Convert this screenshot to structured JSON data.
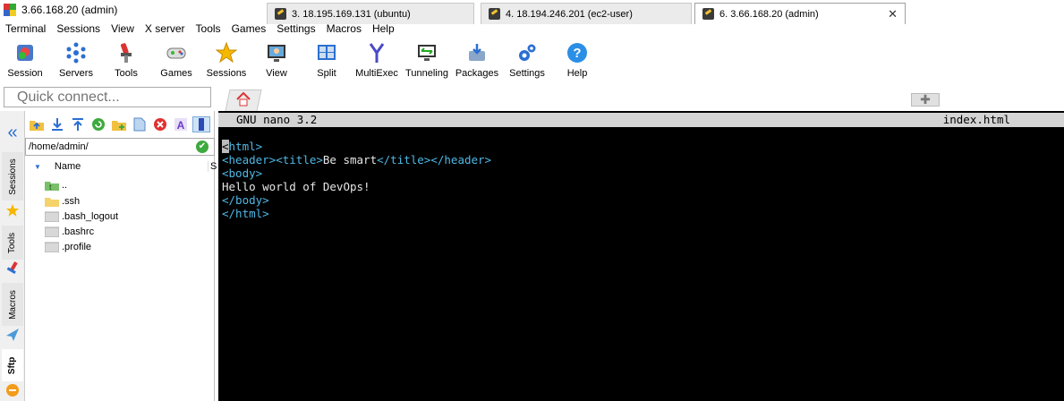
{
  "window": {
    "title": "3.66.168.20 (admin)"
  },
  "menu": [
    "Terminal",
    "Sessions",
    "View",
    "X server",
    "Tools",
    "Games",
    "Settings",
    "Macros",
    "Help"
  ],
  "toolbar": [
    {
      "label": "Session",
      "icon": "session-icon"
    },
    {
      "label": "Servers",
      "icon": "servers-icon"
    },
    {
      "label": "Tools",
      "icon": "tools-icon"
    },
    {
      "label": "Games",
      "icon": "games-icon"
    },
    {
      "label": "Sessions",
      "icon": "star-icon"
    },
    {
      "label": "View",
      "icon": "view-icon"
    },
    {
      "label": "Split",
      "icon": "split-icon"
    },
    {
      "label": "MultiExec",
      "icon": "multiexec-icon"
    },
    {
      "label": "Tunneling",
      "icon": "tunneling-icon"
    },
    {
      "label": "Packages",
      "icon": "packages-icon"
    },
    {
      "label": "Settings",
      "icon": "gears-icon"
    },
    {
      "label": "Help",
      "icon": "help-icon"
    }
  ],
  "quick_connect": {
    "placeholder": "Quick connect..."
  },
  "tabs": [
    {
      "label": "3. 18.195.169.131 (ubuntu)",
      "active": false
    },
    {
      "label": "4. 18.194.246.201 (ec2-user)",
      "active": false
    },
    {
      "label": "6. 3.66.168.20 (admin)",
      "active": true
    }
  ],
  "side_tabs": [
    "Sessions",
    "Tools",
    "Macros",
    "Sftp"
  ],
  "sftp": {
    "path": "/home/admin/",
    "column_name": "Name",
    "column_size": "S",
    "files": [
      {
        "name": "..",
        "type": "parent"
      },
      {
        "name": ".ssh",
        "type": "folder"
      },
      {
        "name": ".bash_logout",
        "type": "file"
      },
      {
        "name": ".bashrc",
        "type": "file"
      },
      {
        "name": ".profile",
        "type": "file"
      }
    ]
  },
  "editor": {
    "version": "GNU nano 3.2",
    "filename": "index.html",
    "lines": [
      "<html>",
      "<header><title>Be smart</title></header>",
      "<body>",
      "Hello world of DevOps!",
      "</body>",
      "</html>"
    ]
  },
  "colors": {
    "accent": "#2b6fd1",
    "terminal_bg": "#000000",
    "tag": "#4fb8e6",
    "nano_bar": "#d4d4d4"
  }
}
